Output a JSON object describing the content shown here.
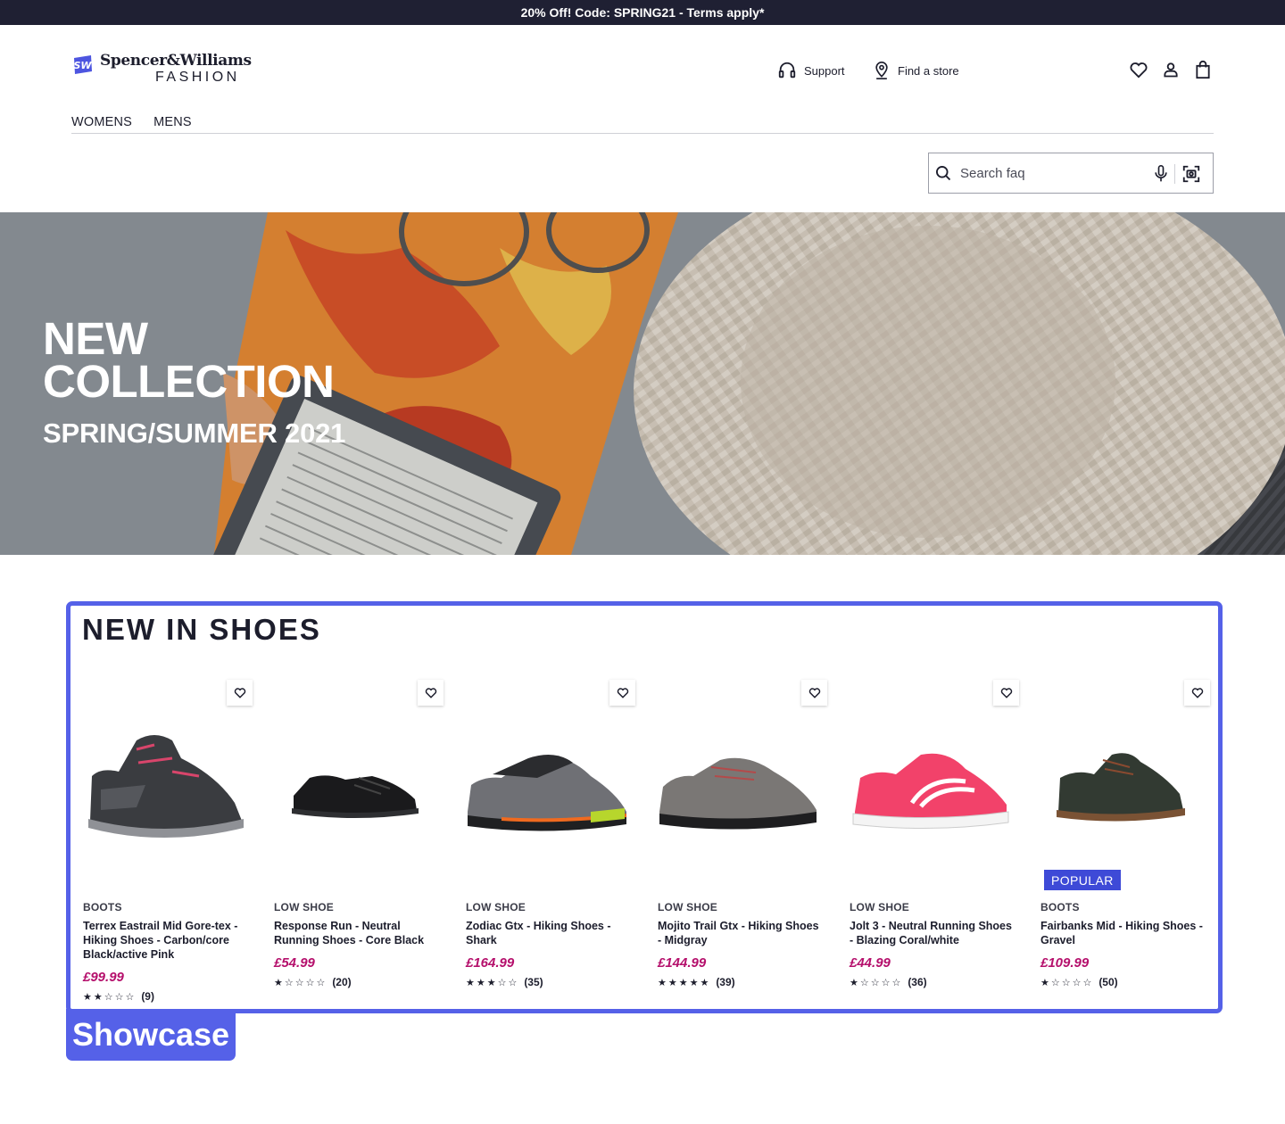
{
  "promo": "20% Off! Code: SPRING21 - Terms apply*",
  "brand": {
    "mark": "SW",
    "name": "Spencer&Williams",
    "sub": "FASHION"
  },
  "header": {
    "support": "Support",
    "store": "Find a store"
  },
  "nav": [
    "WOMENS",
    "MENS"
  ],
  "search": {
    "placeholder": "Search faq"
  },
  "hero": {
    "title_line1": "NEW",
    "title_line2": "COLLECTION",
    "subtitle": "SPRING/SUMMER 2021"
  },
  "showcase": {
    "title": "NEW IN SHOES",
    "tag": "Showcase",
    "products": [
      {
        "category": "BOOTS",
        "name": "Terrex Eastrail Mid Gore-tex - Hiking Shoes - Carbon/core Black/active Pink",
        "price": "£99.99",
        "rating": 2,
        "stars": "★★☆☆☆",
        "count": "(9)",
        "badge": ""
      },
      {
        "category": "LOW SHOE",
        "name": "Response Run - Neutral Running Shoes - Core Black",
        "price": "£54.99",
        "rating": 1,
        "stars": "★☆☆☆☆",
        "count": "(20)",
        "badge": ""
      },
      {
        "category": "LOW SHOE",
        "name": "Zodiac Gtx - Hiking Shoes - Shark",
        "price": "£164.99",
        "rating": 3,
        "stars": "★★★☆☆",
        "count": "(35)",
        "badge": ""
      },
      {
        "category": "LOW SHOE",
        "name": "Mojito Trail Gtx - Hiking Shoes - Midgray",
        "price": "£144.99",
        "rating": 5,
        "stars": "★★★★★",
        "count": "(39)",
        "badge": ""
      },
      {
        "category": "LOW SHOE",
        "name": "Jolt 3 - Neutral Running Shoes - Blazing Coral/white",
        "price": "£44.99",
        "rating": 1,
        "stars": "★☆☆☆☆",
        "count": "(36)",
        "badge": ""
      },
      {
        "category": "BOOTS",
        "name": "Fairbanks Mid - Hiking Shoes - Gravel",
        "price": "£109.99",
        "rating": 1,
        "stars": "★☆☆☆☆",
        "count": "(50)",
        "badge": "POPULAR"
      }
    ]
  },
  "colors": {
    "accent": "#5561e8",
    "price": "#b5106c",
    "badge": "#3e4ad7",
    "promo_bg": "#1f2033"
  },
  "icons": [
    "support-headset-icon",
    "location-pin-icon",
    "heart-icon",
    "user-icon",
    "shopping-bag-icon",
    "search-icon",
    "microphone-icon",
    "camera-scan-icon"
  ]
}
